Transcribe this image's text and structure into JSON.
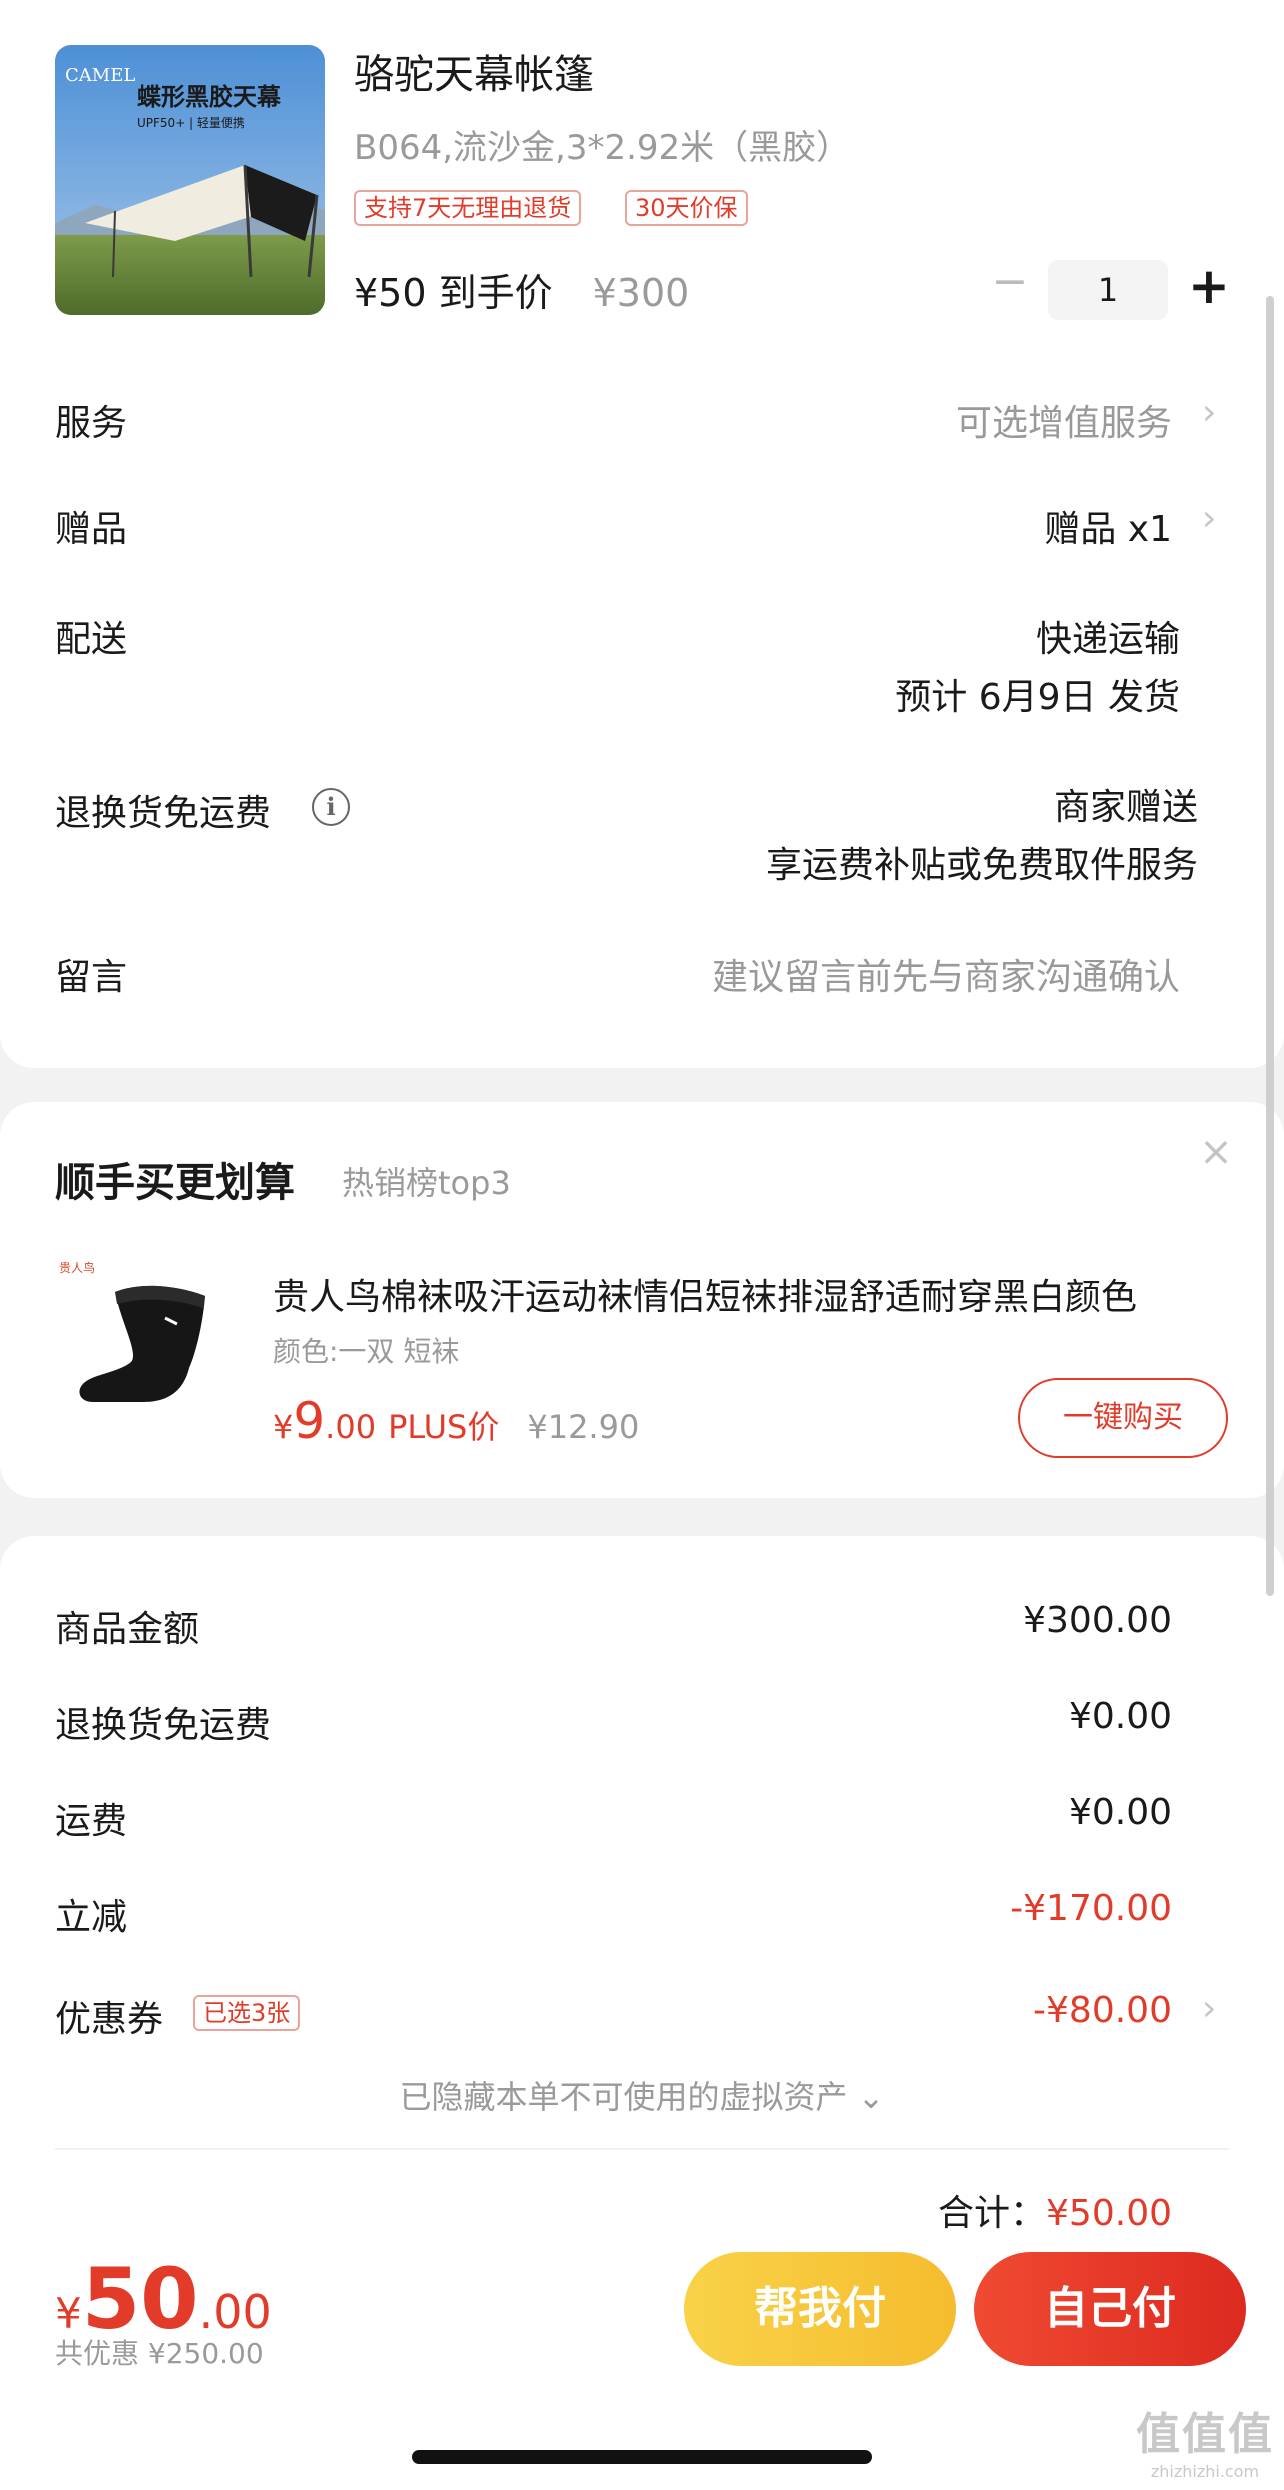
{
  "product": {
    "image_label": "蝶形黑胶天幕",
    "image_brand": "CAMEL",
    "image_badge": "UPF50+ | 轻量便携",
    "title": "骆驼天幕帐篷",
    "spec": "B064,流沙金,3*2.92米（黑胶）",
    "tags": [
      "支持7天无理由退货",
      "30天价保"
    ],
    "final_price": "¥50 到手价",
    "original_price": "¥300",
    "quantity": "1",
    "qty_minus": "−",
    "qty_plus": "+"
  },
  "order_rows": {
    "service_label": "服务",
    "service_value": "可选增值服务",
    "gift_label": "赠品",
    "gift_value": "赠品 x1",
    "delivery_label": "配送",
    "delivery_method": "快递运输",
    "delivery_eta": "预计 6月9日 发货",
    "return_label": "退换货免运费",
    "return_value_1": "商家赠送",
    "return_value_2": "享运费补贴或免费取件服务",
    "message_label": "留言",
    "message_placeholder": "建议留言前先与商家沟通确认",
    "chevron": "›"
  },
  "recommend": {
    "title": "顺手买更划算",
    "subtitle": "热销榜top3",
    "close": "×",
    "item_name": "贵人鸟棉袜吸汗运动袜情侣短袜排湿舒适耐穿黑白颜色",
    "item_spec": "颜色:一双 短袜",
    "price_symbol": "¥",
    "price_int": "9",
    "price_dec": ".00",
    "plus_label": "PLUS价",
    "was_price": "¥12.90",
    "buy_button": "一键购买",
    "brand_mark": "贵人鸟"
  },
  "summary": {
    "goods_label": "商品金额",
    "goods_value": "¥300.00",
    "return_fee_label": "退换货免运费",
    "return_fee_value": "¥0.00",
    "shipping_label": "运费",
    "shipping_value": "¥0.00",
    "discount_label": "立减",
    "discount_value": "-¥170.00",
    "coupon_label": "优惠券",
    "coupon_tag": "已选3张",
    "coupon_value": "-¥80.00",
    "hidden_note": "已隐藏本单不可使用的虚拟资产 ⌄",
    "total_label": "合计：",
    "total_value": "¥50.00"
  },
  "bottom_bar": {
    "symbol": "¥",
    "amount_int": "50",
    "amount_dec": ".00",
    "saved": "共优惠 ¥250.00",
    "help_pay": "帮我付",
    "self_pay": "自己付"
  },
  "watermark": {
    "logo": "值值值",
    "site": "zhizhizhi.com"
  },
  "colors": {
    "accent_red": "#e23b2a",
    "help_yellow": "#f7c63a",
    "background": "#f2f2f2"
  }
}
